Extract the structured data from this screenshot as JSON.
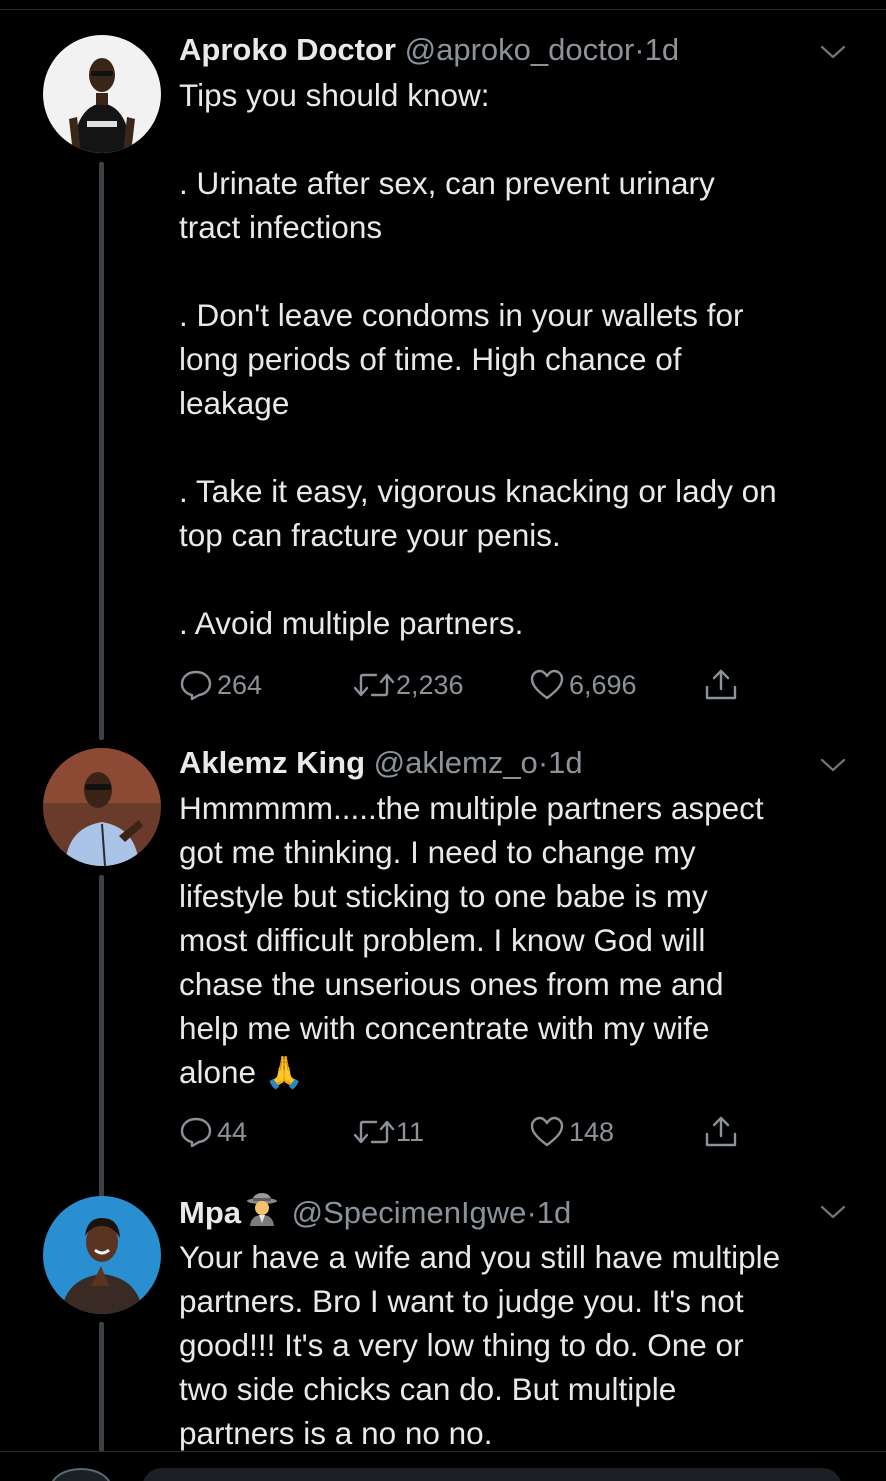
{
  "tweets": [
    {
      "display_name": "Aproko Doctor",
      "handle": "@aproko_doctor",
      "separator": "·",
      "time": "1d",
      "text": "Tips you should know:\n\n. Urinate after sex, can prevent urinary\ntract infections\n\n. Don't leave condoms in your wallets for\nlong periods of time. High chance of\nleakage\n\n. Take it easy, vigorous knacking or lady on\ntop can fracture your penis.\n\n. Avoid multiple partners.",
      "replies": "264",
      "retweets": "2,236",
      "likes": "6,696"
    },
    {
      "display_name": "Aklemz King",
      "handle": "@aklemz_o",
      "separator": "·",
      "time": "1d",
      "text": "Hmmmmm.....the multiple partners aspect\ngot me thinking. I need to change my\nlifestyle but sticking to one babe is my\nmost difficult problem. I know God will\nchase the unserious ones from me and\nhelp me with concentrate with my wife\nalone 🙏",
      "replies": "44",
      "retweets": "11",
      "likes": "148"
    },
    {
      "display_name": "Mpa",
      "name_emoji": "detective-emoji",
      "handle": "@SpecimenIgwe",
      "separator": "·",
      "time": "1d",
      "text": "Your have a wife and you still have multiple\npartners. Bro I want to judge you. It's not\ngood!!! It's a very low thing to do. One or\ntwo side chicks can do. But multiple\npartners is a no no no."
    }
  ],
  "icons": {
    "reply": "reply-icon",
    "retweet": "retweet-icon",
    "like": "heart-icon",
    "share": "share-icon",
    "more": "chevron-down-icon"
  },
  "colors": {
    "background": "#000000",
    "text": "#e7e9ea",
    "secondary": "#8b9299",
    "thread_line": "#3d4146"
  }
}
